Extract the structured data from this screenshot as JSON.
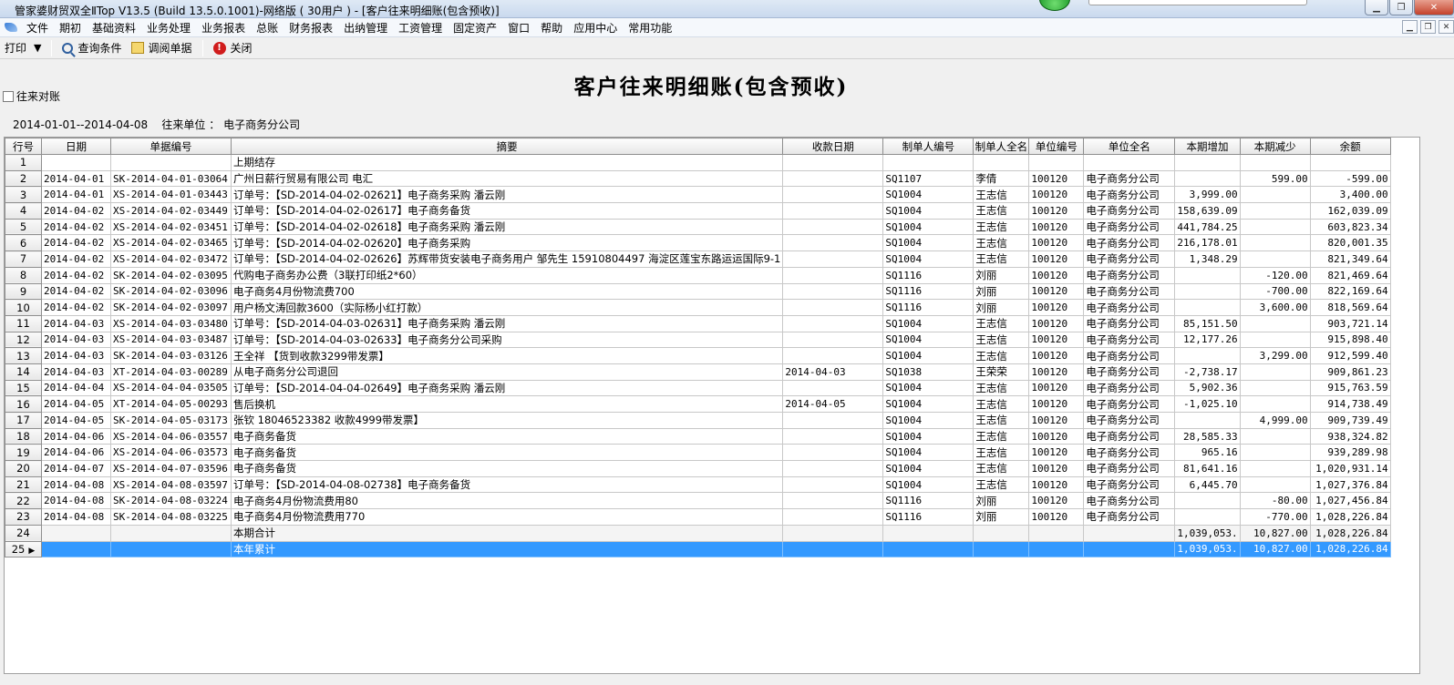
{
  "window": {
    "title": "管家婆财贸双全ⅡTop V13.5 (Build 13.5.0.1001)-网络版 ( 30用户 ) - [客户往来明细账(包含预收)]"
  },
  "menu": [
    "文件",
    "期初",
    "基础资料",
    "业务处理",
    "业务报表",
    "总账",
    "财务报表",
    "出纳管理",
    "工资管理",
    "固定资产",
    "窗口",
    "帮助",
    "应用中心",
    "常用功能"
  ],
  "toolbar": {
    "print_label": "打印",
    "query_label": "查询条件",
    "view_label": "调阅单据",
    "close_label": "关闭"
  },
  "report": {
    "title": "客户往来明细账(包含预收)",
    "checkbox_label": "往来对账",
    "date_range": "2014-01-01--2014-04-08",
    "unit_label": "往来单位 ：",
    "unit_value": "电子商务分公司"
  },
  "table": {
    "columns": [
      "行号",
      "日期",
      "单据编号",
      "摘要",
      "收款日期",
      "制单人编号",
      "制单人全名",
      "单位编号",
      "单位全名",
      "本期增加",
      "本期减少",
      "余额"
    ],
    "rows": [
      [
        "1",
        "",
        "",
        "上期结存",
        "",
        "",
        "",
        "",
        "",
        "",
        "",
        ""
      ],
      [
        "2",
        "2014-04-01",
        "SK-2014-04-01-03064",
        "广州日薪行贸易有限公司    电汇",
        "",
        "SQ1107",
        "李倩",
        "100120",
        "电子商务分公司",
        "",
        "599.00",
        "-599.00"
      ],
      [
        "3",
        "2014-04-01",
        "XS-2014-04-01-03443",
        "订单号：【SD-2014-04-02-02621】电子商务采购 潘云刚",
        "",
        "SQ1004",
        "王志信",
        "100120",
        "电子商务分公司",
        "3,999.00",
        "",
        "3,400.00"
      ],
      [
        "4",
        "2014-04-02",
        "XS-2014-04-02-03449",
        "订单号：【SD-2014-04-02-02617】电子商务备货",
        "",
        "SQ1004",
        "王志信",
        "100120",
        "电子商务分公司",
        "158,639.09",
        "",
        "162,039.09"
      ],
      [
        "5",
        "2014-04-02",
        "XS-2014-04-02-03451",
        "订单号：【SD-2014-04-02-02618】电子商务采购 潘云刚",
        "",
        "SQ1004",
        "王志信",
        "100120",
        "电子商务分公司",
        "441,784.25",
        "",
        "603,823.34"
      ],
      [
        "6",
        "2014-04-02",
        "XS-2014-04-02-03465",
        "订单号：【SD-2014-04-02-02620】电子商务采购",
        "",
        "SQ1004",
        "王志信",
        "100120",
        "电子商务分公司",
        "216,178.01",
        "",
        "820,001.35"
      ],
      [
        "7",
        "2014-04-02",
        "XS-2014-04-02-03472",
        "订单号：【SD-2014-04-02-02626】苏辉带货安装电子商务用户 邹先生 15910804497 海淀区莲宝东路运运国际9-1",
        "",
        "SQ1004",
        "王志信",
        "100120",
        "电子商务分公司",
        "1,348.29",
        "",
        "821,349.64"
      ],
      [
        "8",
        "2014-04-02",
        "SK-2014-04-02-03095",
        "代购电子商务办公费（3联打印纸2*60）",
        "",
        "SQ1116",
        "刘丽",
        "100120",
        "电子商务分公司",
        "",
        "-120.00",
        "821,469.64"
      ],
      [
        "9",
        "2014-04-02",
        "SK-2014-04-02-03096",
        "电子商务4月份物流费700",
        "",
        "SQ1116",
        "刘丽",
        "100120",
        "电子商务分公司",
        "",
        "-700.00",
        "822,169.64"
      ],
      [
        "10",
        "2014-04-02",
        "SK-2014-04-02-03097",
        "用户杨文涛回款3600（实际杨小红打款）",
        "",
        "SQ1116",
        "刘丽",
        "100120",
        "电子商务分公司",
        "",
        "3,600.00",
        "818,569.64"
      ],
      [
        "11",
        "2014-04-03",
        "XS-2014-04-03-03480",
        "订单号：【SD-2014-04-03-02631】电子商务采购 潘云刚",
        "",
        "SQ1004",
        "王志信",
        "100120",
        "电子商务分公司",
        "85,151.50",
        "",
        "903,721.14"
      ],
      [
        "12",
        "2014-04-03",
        "XS-2014-04-03-03487",
        "订单号：【SD-2014-04-03-02633】电子商务分公司采购",
        "",
        "SQ1004",
        "王志信",
        "100120",
        "电子商务分公司",
        "12,177.26",
        "",
        "915,898.40"
      ],
      [
        "13",
        "2014-04-03",
        "SK-2014-04-03-03126",
        "王全祥 【货到收款3299带发票】",
        "",
        "SQ1004",
        "王志信",
        "100120",
        "电子商务分公司",
        "",
        "3,299.00",
        "912,599.40"
      ],
      [
        "14",
        "2014-04-03",
        "XT-2014-04-03-00289",
        "从电子商务分公司退回",
        "2014-04-03",
        "SQ1038",
        "王荣荣",
        "100120",
        "电子商务分公司",
        "-2,738.17",
        "",
        "909,861.23"
      ],
      [
        "15",
        "2014-04-04",
        "XS-2014-04-04-03505",
        "订单号：【SD-2014-04-04-02649】电子商务采购 潘云刚",
        "",
        "SQ1004",
        "王志信",
        "100120",
        "电子商务分公司",
        "5,902.36",
        "",
        "915,763.59"
      ],
      [
        "16",
        "2014-04-05",
        "XT-2014-04-05-00293",
        "售后换机",
        "2014-04-05",
        "SQ1004",
        "王志信",
        "100120",
        "电子商务分公司",
        "-1,025.10",
        "",
        "914,738.49"
      ],
      [
        "17",
        "2014-04-05",
        "SK-2014-04-05-03173",
        "张钦     18046523382  收款4999带发票】",
        "",
        "SQ1004",
        "王志信",
        "100120",
        "电子商务分公司",
        "",
        "4,999.00",
        "909,739.49"
      ],
      [
        "18",
        "2014-04-06",
        "XS-2014-04-06-03557",
        "电子商务备货",
        "",
        "SQ1004",
        "王志信",
        "100120",
        "电子商务分公司",
        "28,585.33",
        "",
        "938,324.82"
      ],
      [
        "19",
        "2014-04-06",
        "XS-2014-04-06-03573",
        "电子商务备货",
        "",
        "SQ1004",
        "王志信",
        "100120",
        "电子商务分公司",
        "965.16",
        "",
        "939,289.98"
      ],
      [
        "20",
        "2014-04-07",
        "XS-2014-04-07-03596",
        "电子商务备货",
        "",
        "SQ1004",
        "王志信",
        "100120",
        "电子商务分公司",
        "81,641.16",
        "",
        "1,020,931.14"
      ],
      [
        "21",
        "2014-04-08",
        "XS-2014-04-08-03597",
        "订单号：【SD-2014-04-08-02738】电子商务备货",
        "",
        "SQ1004",
        "王志信",
        "100120",
        "电子商务分公司",
        "6,445.70",
        "",
        "1,027,376.84"
      ],
      [
        "22",
        "2014-04-08",
        "SK-2014-04-08-03224",
        "电子商务4月份物流费用80",
        "",
        "SQ1116",
        "刘丽",
        "100120",
        "电子商务分公司",
        "",
        "-80.00",
        "1,027,456.84"
      ],
      [
        "23",
        "2014-04-08",
        "SK-2014-04-08-03225",
        "电子商务4月份物流费用770",
        "",
        "SQ1116",
        "刘丽",
        "100120",
        "电子商务分公司",
        "",
        "-770.00",
        "1,028,226.84"
      ],
      [
        "24",
        "",
        "",
        "本期合计",
        "",
        "",
        "",
        "",
        "",
        "1,039,053.",
        "10,827.00",
        "1,028,226.84"
      ],
      [
        "25",
        "",
        "",
        "本年累计",
        "",
        "",
        "",
        "",
        "",
        "1,039,053.",
        "10,827.00",
        "1,028,226.84"
      ]
    ]
  },
  "colors": {
    "selected_row": "#3399ff",
    "close_icon": "#d01c1c"
  }
}
